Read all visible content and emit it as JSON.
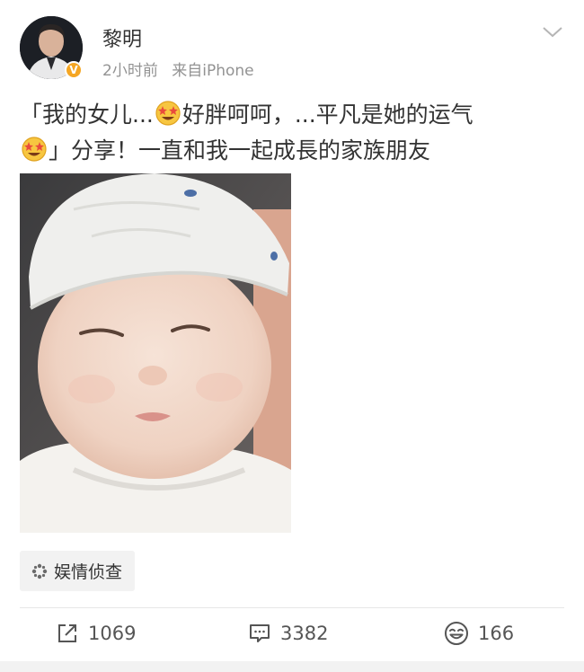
{
  "post": {
    "author": "黎明",
    "time": "2小时前",
    "source": "来自iPhone",
    "text_part1": "「我的女儿...",
    "text_part2": "好胖呵呵，...平凡是她的运气",
    "text_part3": "」分享！一直和我一起成長的家族朋友",
    "emoji": "star-struck-emoji",
    "tag": "娱情侦查"
  },
  "actions": {
    "repost": "1069",
    "comment": "3382",
    "like": "166"
  },
  "icons": [
    "chevron-down-icon",
    "verified-icon",
    "repost-icon",
    "comment-icon",
    "like-icon",
    "tag-icon"
  ]
}
